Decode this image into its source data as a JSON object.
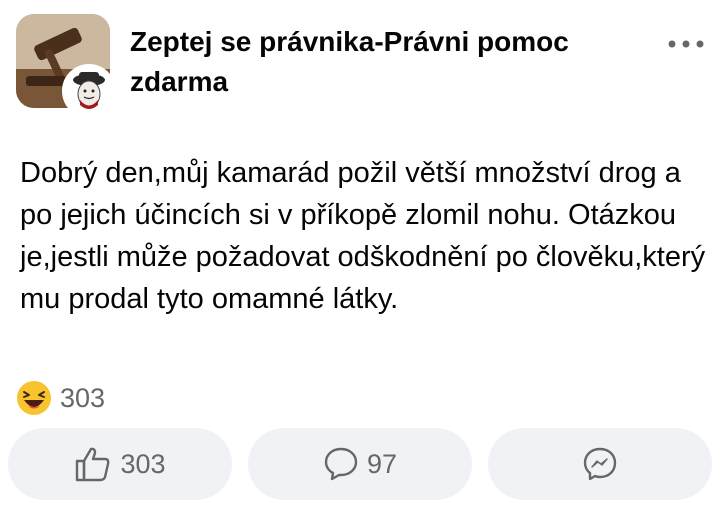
{
  "post": {
    "group_name": "Zeptej se právnika-Právni pomoc zdarma",
    "text": "Dobrý den,můj kamarád požil větší množství drog a po jejich účincích si v příkopě zlomil nohu. Otázkou je,jestli může požadovat odškodnění po člověku,který mu prodal tyto omamné látky."
  },
  "reactions": {
    "icon": "laughing-emoji-icon",
    "count": "303"
  },
  "actions": {
    "like": {
      "icon": "thumbs-up-icon",
      "count": "303"
    },
    "comment": {
      "icon": "comment-bubble-icon",
      "count": "97"
    },
    "share": {
      "icon": "messenger-icon"
    }
  },
  "colors": {
    "text": "#050505",
    "muted": "#65676b",
    "button_bg": "#f0f2f5",
    "emoji_yellow": "#f7c32e"
  }
}
